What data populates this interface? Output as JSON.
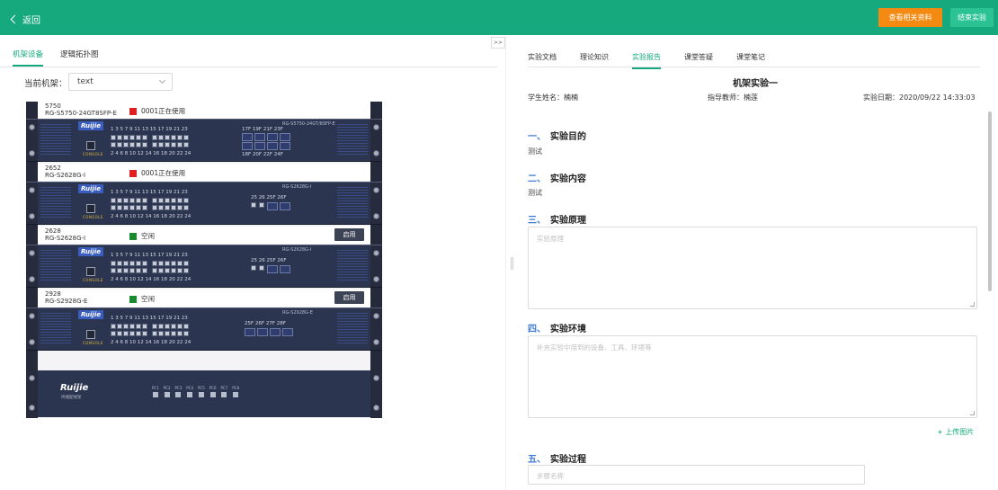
{
  "topbar": {
    "back_label": "返回",
    "view_materials_label": "查看相关资料",
    "end_experiment_label": "结束实验"
  },
  "left": {
    "tabs": [
      {
        "label": "机架设备",
        "active": true
      },
      {
        "label": "逻辑拓扑图",
        "active": false
      }
    ],
    "rack_label": "当前机架：",
    "rack_value": "text",
    "devices": [
      {
        "name": "5750",
        "model": "RG-S5750-24GT8SFP-E",
        "status_text": "0001正在使用",
        "status_color": "#e02020",
        "action": "",
        "panel_model": "RG-S5750-24GT/8SFP-E",
        "ports_top": "1   3   5   7   9   11    13  15  17  19  21  23",
        "ports_bottom": "2   4   6   8  10  12    14  16  18  20  22  24",
        "sfp_top": "17F 19F 21F 23F",
        "sfp_bottom": "18F 20F 22F 24F"
      },
      {
        "name": "2652",
        "model": "RG-S2628G-I",
        "status_text": "0001正在使用",
        "status_color": "#e02020",
        "action": "",
        "panel_model": "RG-S2628G-I",
        "ports_top": "1   3   5   7   9   11    13  15  17  19  21  23",
        "ports_bottom": "2   4   6   8  10  12    14  16  18  20  22  24",
        "sfp_top": "25  26   25F  26F",
        "sfp_bottom": ""
      },
      {
        "name": "2628",
        "model": "RG-S2628G-I",
        "status_text": "空闲",
        "status_color": "#1a8a2e",
        "action": "启用",
        "panel_model": "RG-S2628G-I",
        "ports_top": "1   3   5   7   9   11    13  15  17  19  21  23",
        "ports_bottom": "2   4   6   8  10  12    14  16  18  20  22  24",
        "sfp_top": "25  26   25F  26F",
        "sfp_bottom": ""
      },
      {
        "name": "2928",
        "model": "RG-S2928G-E",
        "status_text": "空闲",
        "status_color": "#1a8a2e",
        "action": "启用",
        "panel_model": "RG-S2928G-E",
        "ports_top": "1   3   5   7   9   11    13  15  17  19  21  23",
        "ports_bottom": "2   4   6   8  10  12    14  16  18  20  22  24",
        "sfp_top": "25F  26F  27F  28F",
        "sfp_bottom": ""
      }
    ],
    "console_label": "CONSOLE",
    "logo_text": "Ruijie",
    "patch": {
      "logo": "Ruijie",
      "subtitle": "终端配线架",
      "pcs": [
        "PC1",
        "PC2",
        "PC3",
        "PC4",
        "PC5",
        "PC6",
        "PC7",
        "PC8"
      ]
    }
  },
  "collapse_label": ">>",
  "right": {
    "tabs": [
      {
        "label": "实验文档",
        "active": false
      },
      {
        "label": "理论知识",
        "active": false
      },
      {
        "label": "实验报告",
        "active": true
      },
      {
        "label": "课堂答疑",
        "active": false
      },
      {
        "label": "课堂笔记",
        "active": false
      }
    ],
    "title": "机架实验一",
    "student": "学生姓名：楠楠",
    "teacher": "指导教师：楠莲",
    "date": "实验日期：2020/09/22 14:33:03",
    "sections": [
      {
        "idx": "一、",
        "title": "实验目的",
        "text": "测试"
      },
      {
        "idx": "二、",
        "title": "实验内容",
        "text": "测试"
      },
      {
        "idx": "三、",
        "title": "实验原理",
        "placeholder": "实验原理"
      },
      {
        "idx": "四、",
        "title": "实验环境",
        "placeholder": "补充实验中用到的设备、工具、环境等"
      },
      {
        "idx": "五、",
        "title": "实验过程",
        "placeholder": "步骤名称"
      }
    ],
    "upload_label": "+ 上传图片"
  }
}
